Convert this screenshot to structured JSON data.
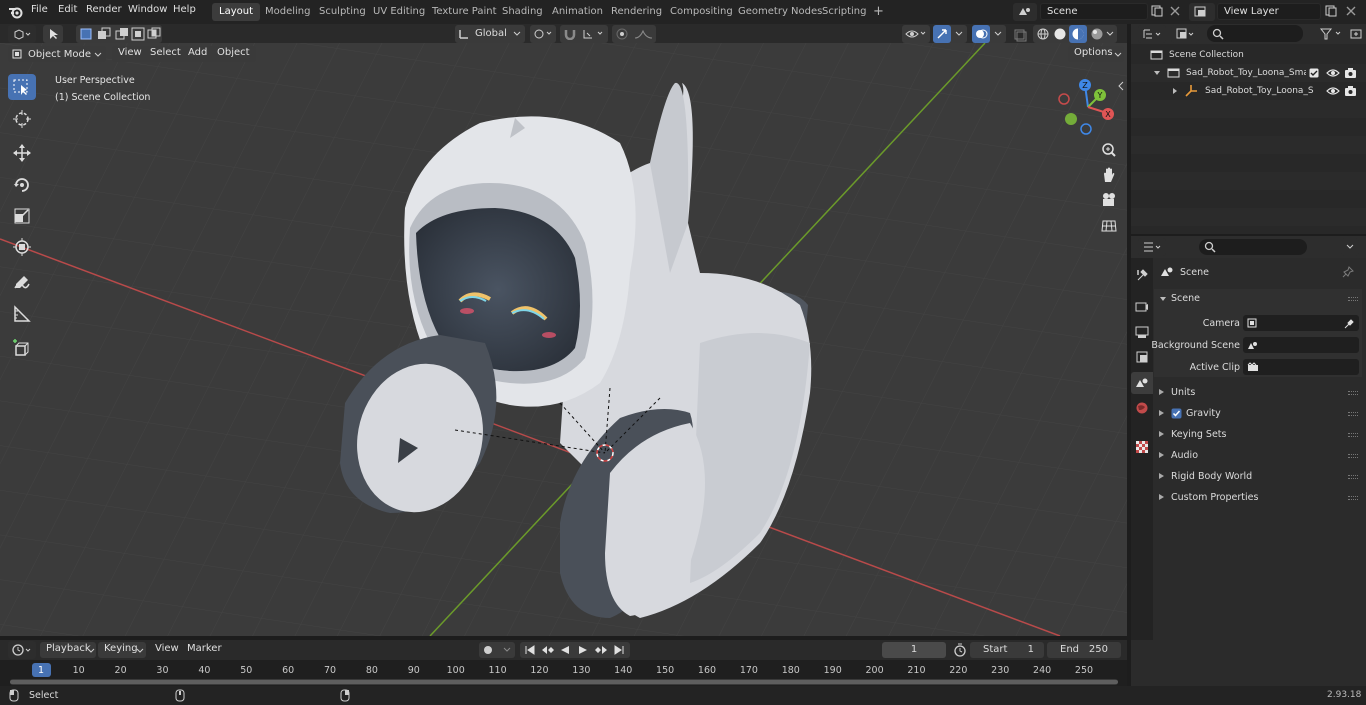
{
  "menu": {
    "items": [
      "File",
      "Edit",
      "Render",
      "Window",
      "Help"
    ]
  },
  "workspaces": {
    "tabs": [
      "Layout",
      "Modeling",
      "Sculpting",
      "UV Editing",
      "Texture Paint",
      "Shading",
      "Animation",
      "Rendering",
      "Compositing",
      "Geometry Nodes",
      "Scripting"
    ],
    "active": "Layout",
    "add_label": "+"
  },
  "scene_field": {
    "value": "Scene"
  },
  "view_layer_field": {
    "value": "View Layer"
  },
  "viewport_header": {
    "mode": "Object Mode",
    "view": "View",
    "select": "Select",
    "add": "Add",
    "object": "Object",
    "orientation": "Global",
    "options": "Options"
  },
  "viewport_overlay": {
    "perspective": "User Perspective",
    "collection": "(1) Scene Collection"
  },
  "gizmo": {
    "x": "X",
    "y": "Y",
    "z": "Z"
  },
  "outliner": {
    "root": "Scene Collection",
    "items": [
      {
        "label": "Sad_Robot_Toy_Loona_Smart"
      },
      {
        "label": "Sad_Robot_Toy_Loona_S"
      }
    ]
  },
  "properties": {
    "context": "Scene",
    "panel_title": "Scene",
    "fields": [
      {
        "label": "Camera"
      },
      {
        "label": "Background Scene"
      },
      {
        "label": "Active Clip"
      }
    ],
    "panels": [
      "Units",
      "Gravity",
      "Keying Sets",
      "Audio",
      "Rigid Body World",
      "Custom Properties"
    ]
  },
  "timeline": {
    "playback": "Playback",
    "keying": "Keying",
    "view": "View",
    "marker": "Marker",
    "current_frame": "1",
    "start_label": "Start",
    "start_value": "1",
    "end_label": "End",
    "end_value": "250",
    "ticks": [
      "1",
      "10",
      "20",
      "30",
      "40",
      "50",
      "60",
      "70",
      "80",
      "90",
      "100",
      "110",
      "120",
      "130",
      "140",
      "150",
      "160",
      "170",
      "180",
      "190",
      "200",
      "210",
      "220",
      "230",
      "240",
      "250"
    ]
  },
  "status": {
    "select": "Select",
    "version": "2.93.18"
  },
  "colors": {
    "accent": "#4772b3",
    "x_axis": "#b84a4a",
    "y_axis": "#6b9a2a",
    "gizmo_x": "#e05555",
    "gizmo_y": "#7fc13a",
    "gizmo_z": "#3f88e8"
  }
}
